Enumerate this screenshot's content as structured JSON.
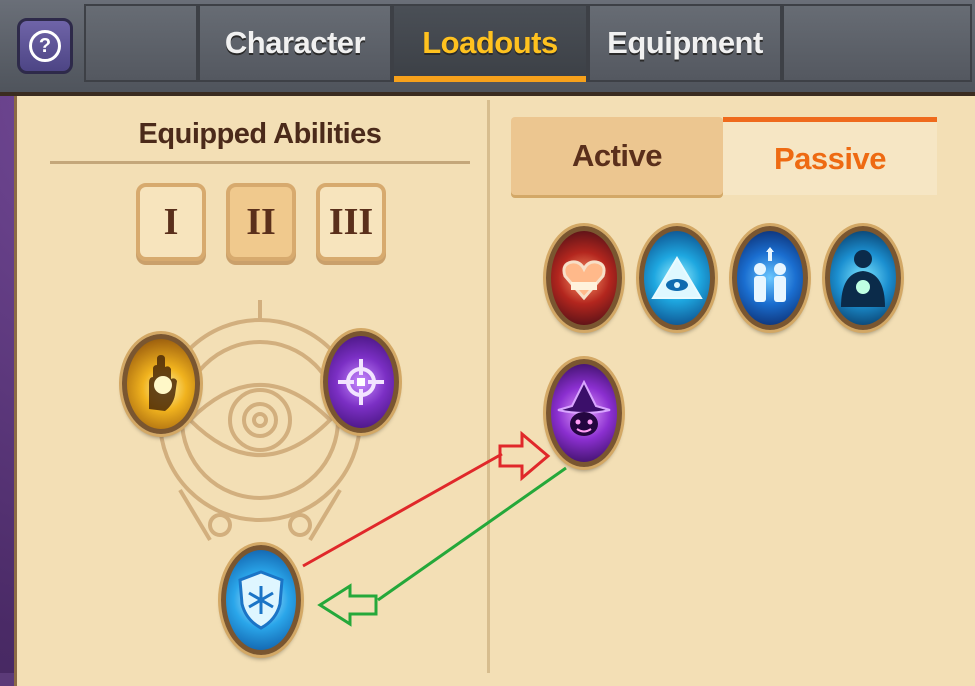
{
  "top_tabs": [
    {
      "label": "Character",
      "active": false
    },
    {
      "label": "Loadouts",
      "active": true
    },
    {
      "label": "Equipment",
      "active": false
    }
  ],
  "help_button": {
    "icon": "question-icon",
    "label": "?"
  },
  "equipped": {
    "title": "Equipped Abilities",
    "slots": [
      {
        "label": "I",
        "selected": false
      },
      {
        "label": "II",
        "selected": true
      },
      {
        "label": "III",
        "selected": false
      }
    ],
    "abilities": [
      {
        "name": "radiant-hand-icon",
        "color": "#e8a21a"
      },
      {
        "name": "crosshair-sigil-icon",
        "color": "#7b2fc4"
      },
      {
        "name": "frost-shield-icon",
        "color": "#2aa6ea"
      }
    ]
  },
  "ability_types": {
    "active_label": "Active",
    "passive_label": "Passive",
    "selected": "Passive"
  },
  "passive_abilities": [
    {
      "name": "flaming-heart-icon",
      "color": "#c23a2c"
    },
    {
      "name": "all-seeing-eye-icon",
      "color": "#1ea7e0"
    },
    {
      "name": "twin-figures-icon",
      "color": "#1a8be0"
    },
    {
      "name": "glowing-core-figure-icon",
      "color": "#1f9fd6"
    },
    {
      "name": "shadow-wizard-icon",
      "color": "#8b2fd0"
    }
  ],
  "colors": {
    "accent": "#ffc21f",
    "passive_orange": "#ee6a12",
    "parchment": "#f3dfb5",
    "swap_out_arrow": "#e0282a",
    "swap_in_arrow": "#25a83a"
  }
}
